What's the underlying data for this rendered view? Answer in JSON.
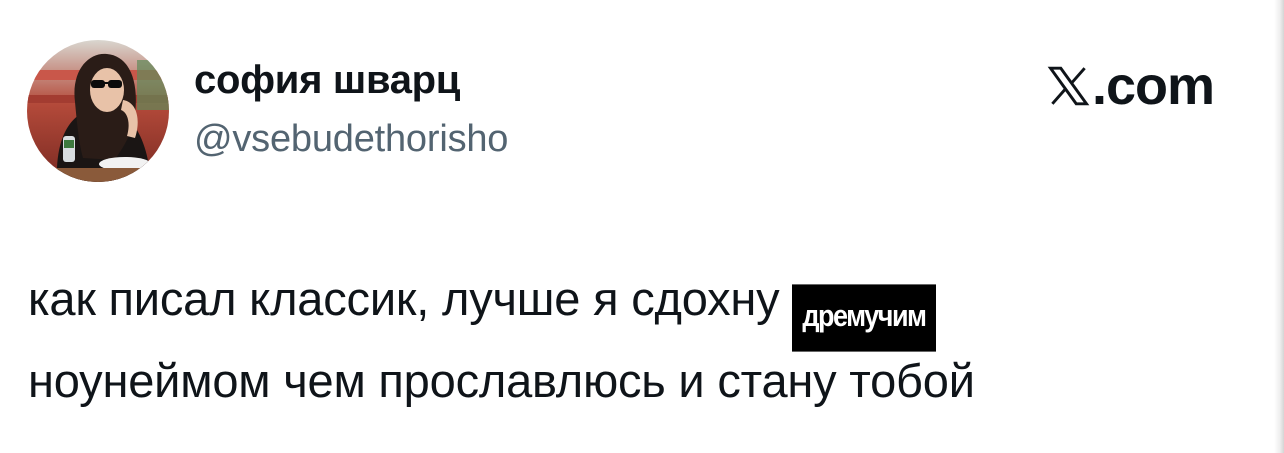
{
  "tweet": {
    "author": {
      "display_name": "софия шварц",
      "handle": "@vsebudethorisho"
    },
    "brand": {
      "text": ".com",
      "icon": "x-logo-icon"
    },
    "body": {
      "line1": "как писал классик, лучше я сдохну",
      "sticker": "дремучим",
      "line2": "ноунеймом чем прославлюсь и стану тобой"
    }
  },
  "colors": {
    "text_primary": "#0f1419",
    "text_secondary": "#536471",
    "sticker_bg": "#000000",
    "sticker_text": "#ffffff",
    "background": "#ffffff"
  }
}
